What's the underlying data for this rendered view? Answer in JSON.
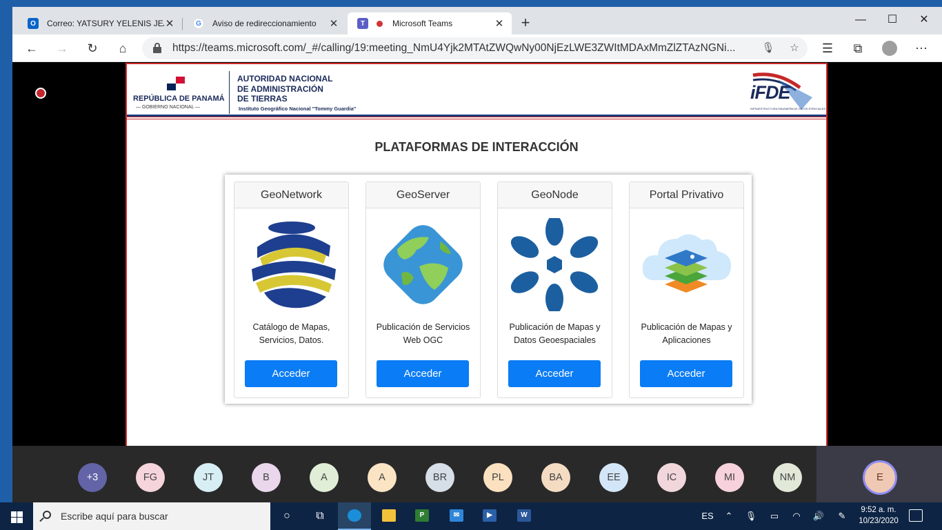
{
  "browser": {
    "tabs": [
      {
        "title": "Correo: YATSURY YELENIS JEAN I",
        "favicon": "outlook-icon"
      },
      {
        "title": "Aviso de redireccionamiento",
        "favicon": "google-icon"
      },
      {
        "title": "Microsoft Teams",
        "favicon": "teams-icon",
        "recording": true
      }
    ],
    "new_tab": "+",
    "url": "https://teams.microsoft.com/_#/calling/19:meeting_NmU4Yjk2MTAtZWQwNy00NjEzLWE3ZWItMDAxMmZlZTAzNGNi..."
  },
  "slide": {
    "republica": "REPÚBLICA DE PANAMÁ",
    "gobierno": "GOBIERNO NACIONAL",
    "authority_lines": [
      "AUTORIDAD NACIONAL",
      "DE ADMINISTRACIÓN",
      "DE TIERRAS"
    ],
    "institute": "Instituto Geográfico Nacional \"Tommy Guardia\"",
    "ifde": "iFDE",
    "ifde_sub": "INFRAESTRUCTURA PANAMEÑA DE DATOS ESPACIALES",
    "title": "PLATAFORMAS DE INTERACCIÓN",
    "cards": [
      {
        "name": "GeoNetwork",
        "desc": "Catálogo de Mapas, Servicios, Datos.",
        "button": "Acceder",
        "icon": "geonetwork-logo"
      },
      {
        "name": "GeoServer",
        "desc": "Publicación de Servicios Web OGC",
        "button": "Acceder",
        "icon": "geoserver-globe-logo"
      },
      {
        "name": "GeoNode",
        "desc": "Publicación de Mapas y Datos Geoespaciales",
        "button": "Acceder",
        "icon": "geonode-logo"
      },
      {
        "name": "Portal Privativo",
        "desc": "Publicación de Mapas y Aplicaciones",
        "button": "Acceder",
        "icon": "cloud-layers-logo"
      }
    ]
  },
  "participants": [
    {
      "initials": "+3",
      "color": "#6264a7"
    },
    {
      "initials": "FG",
      "color": "#f6d4dc"
    },
    {
      "initials": "JT",
      "color": "#d7eef4"
    },
    {
      "initials": "B",
      "color": "#ead7ec"
    },
    {
      "initials": "A",
      "color": "#e0eed7"
    },
    {
      "initials": "A",
      "color": "#fbe4c4"
    },
    {
      "initials": "BR",
      "color": "#d6dee8"
    },
    {
      "initials": "PL",
      "color": "#fbe1bf"
    },
    {
      "initials": "BA",
      "color": "#f4dcc3"
    },
    {
      "initials": "EE",
      "color": "#d3e6f7"
    },
    {
      "initials": "IC",
      "color": "#f1d7dc"
    },
    {
      "initials": "MI",
      "color": "#f7d1dc"
    },
    {
      "initials": "NM",
      "color": "#e1e8d8"
    }
  ],
  "self": {
    "initials": "E"
  },
  "taskbar": {
    "search_placeholder": "Escribe aquí para buscar",
    "language": "ES",
    "time": "9:52 a. m.",
    "date": "10/23/2020"
  }
}
